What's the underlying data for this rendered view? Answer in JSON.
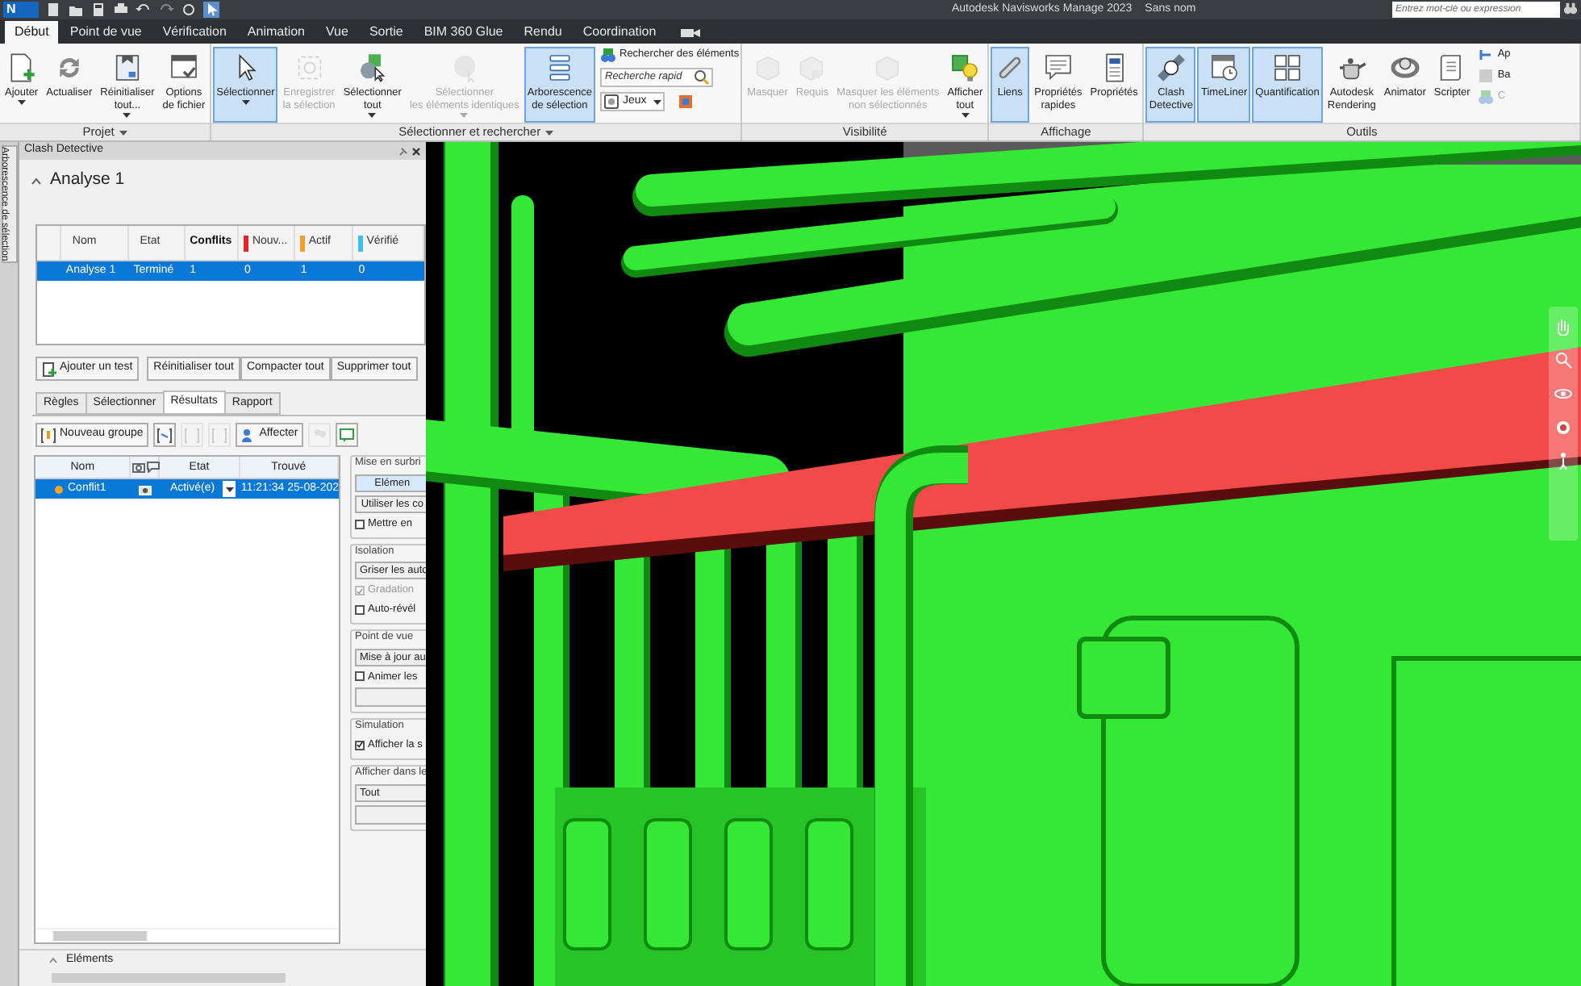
{
  "title_bar": {
    "logo": "N",
    "app_title": "Autodesk Navisworks Manage 2023",
    "document_title": "Sans nom",
    "search": {
      "placeholder": "Entrez mot-clé ou expression"
    }
  },
  "ribbon_tabs": [
    {
      "label": "Début",
      "selected": true
    },
    {
      "label": "Point de vue",
      "selected": false
    },
    {
      "label": "Vérification",
      "selected": false
    },
    {
      "label": "Animation",
      "selected": false
    },
    {
      "label": "Vue",
      "selected": false
    },
    {
      "label": "Sortie",
      "selected": false
    },
    {
      "label": "BIM 360 Glue",
      "selected": false
    },
    {
      "label": "Rendu",
      "selected": false
    },
    {
      "label": "Coordination",
      "selected": false
    }
  ],
  "ribbon_groups": [
    {
      "label": "Projet",
      "items": [
        {
          "kind": "large",
          "label": "Ajouter",
          "dropdown": true,
          "selected": false,
          "disabled": false
        },
        {
          "kind": "large",
          "label": "Actualiser",
          "dropdown": false,
          "selected": false,
          "disabled": false
        },
        {
          "kind": "large",
          "label": "Réinitialiser\ntout...",
          "dropdown": true,
          "selected": false,
          "disabled": false
        },
        {
          "kind": "large",
          "label": "Options\nde fichier",
          "dropdown": false,
          "selected": false,
          "disabled": false
        }
      ]
    },
    {
      "label": "Sélectionner et rechercher",
      "items": [
        {
          "kind": "large",
          "label": "Sélectionner",
          "dropdown": true,
          "selected": true,
          "disabled": false
        },
        {
          "kind": "large",
          "label": "Enregistrer\nla sélection",
          "dropdown": false,
          "selected": false,
          "disabled": true
        },
        {
          "kind": "large",
          "label": "Sélectionner\ntout",
          "dropdown": true,
          "selected": false,
          "disabled": false
        },
        {
          "kind": "large",
          "label": "Sélectionner\nles éléments identiques",
          "dropdown": true,
          "selected": false,
          "disabled": true
        },
        {
          "kind": "large",
          "label": "Arborescence\nde sélection",
          "dropdown": false,
          "selected": true,
          "disabled": false
        },
        {
          "kind": "stack",
          "entries": [
            {
              "kind": "link",
              "label": "Rechercher des éléments"
            },
            {
              "kind": "search",
              "placeholder": "Recherche rapid"
            },
            {
              "kind": "select",
              "label": "Jeux"
            }
          ]
        }
      ]
    },
    {
      "label": "Visibilité",
      "items": [
        {
          "kind": "large",
          "label": "Masquer",
          "dropdown": false,
          "selected": false,
          "disabled": true
        },
        {
          "kind": "large",
          "label": "Requis",
          "dropdown": false,
          "selected": false,
          "disabled": true
        },
        {
          "kind": "large",
          "label": "Masquer les éléments\nnon sélectionnés",
          "dropdown": false,
          "selected": false,
          "disabled": true
        },
        {
          "kind": "large",
          "label": "Afficher\ntout",
          "dropdown": true,
          "selected": false,
          "disabled": false
        }
      ]
    },
    {
      "label": "Affichage",
      "items": [
        {
          "kind": "large",
          "label": "Liens",
          "dropdown": false,
          "selected": true,
          "disabled": false
        },
        {
          "kind": "large",
          "label": "Propriétés\nrapides",
          "dropdown": false,
          "selected": false,
          "disabled": false
        },
        {
          "kind": "large",
          "label": "Propriétés",
          "dropdown": false,
          "selected": false,
          "disabled": false
        }
      ]
    },
    {
      "label": "Outils",
      "items": [
        {
          "kind": "large",
          "label": "Clash\nDetective",
          "dropdown": false,
          "selected": true,
          "disabled": false
        },
        {
          "kind": "large",
          "label": "TimeLiner",
          "dropdown": false,
          "selected": true,
          "disabled": false
        },
        {
          "kind": "large",
          "label": "Quantification",
          "dropdown": false,
          "selected": true,
          "disabled": false
        },
        {
          "kind": "large",
          "label": "Autodesk\nRendering",
          "dropdown": false,
          "selected": false,
          "disabled": false
        },
        {
          "kind": "large",
          "label": "Animator",
          "dropdown": false,
          "selected": false,
          "disabled": false
        },
        {
          "kind": "large",
          "label": "Scripter",
          "dropdown": false,
          "selected": false,
          "disabled": false
        },
        {
          "kind": "stack",
          "entries": [
            {
              "kind": "link",
              "label": "Ap"
            },
            {
              "kind": "link",
              "label": "Ba"
            },
            {
              "kind": "disabled_link",
              "label": "C"
            }
          ]
        }
      ]
    }
  ],
  "side_tab": {
    "label": "Arborescence de sélection"
  },
  "clash_detective": {
    "title": "Clash Detective",
    "test_name": "Analyse 1",
    "tests_table": {
      "columns": [
        {
          "label": "Nom",
          "kind": "text"
        },
        {
          "label": "Etat",
          "kind": "text"
        },
        {
          "label": "Conflits",
          "kind": "total"
        },
        {
          "label": "Nouv...",
          "kind": "status",
          "color": "#e0262c"
        },
        {
          "label": "Actif",
          "kind": "status",
          "color": "#f0a030"
        },
        {
          "label": "Vérifié",
          "kind": "status",
          "color": "#3cc0e8"
        }
      ],
      "rows": [
        {
          "selected": true,
          "cells": [
            "Analyse 1",
            "Terminé",
            "1",
            "0",
            "1",
            "0"
          ]
        }
      ]
    },
    "test_buttons": [
      "Ajouter un test",
      "Réinitialiser tout",
      "Compacter tout",
      "Supprimer tout"
    ],
    "tabs": [
      {
        "label": "Règles",
        "selected": false
      },
      {
        "label": "Sélectionner",
        "selected": false
      },
      {
        "label": "Résultats",
        "selected": true
      },
      {
        "label": "Rapport",
        "selected": false
      }
    ],
    "results_toolbar": [
      {
        "kind": "labeled",
        "label": "Nouveau groupe",
        "disabled": false
      },
      {
        "kind": "icon",
        "disabled": false
      },
      {
        "kind": "icon",
        "disabled": true
      },
      {
        "kind": "icon",
        "disabled": true
      },
      {
        "kind": "labeled",
        "label": "Affecter",
        "disabled": false
      },
      {
        "kind": "icon",
        "disabled": true
      },
      {
        "kind": "icon",
        "disabled": false
      }
    ],
    "results_table": {
      "columns": [
        "Nom",
        "Etat",
        "Trouvé"
      ],
      "rows": [
        {
          "name": "Conflit1",
          "color": "#f5a623",
          "status": "Activé(e)",
          "found": "11:21:34 25-08-202",
          "selected": true
        }
      ]
    },
    "options": [
      {
        "title": "Mise en surbri",
        "controls": [
          {
            "kind": "button",
            "label": "Elémen",
            "selected": true
          },
          {
            "kind": "button",
            "label": "Utiliser les co",
            "selected": false
          },
          {
            "kind": "checkbox",
            "label": "Mettre en",
            "checked": false,
            "disabled": false
          }
        ]
      },
      {
        "title": "Isolation",
        "controls": [
          {
            "kind": "dropdown",
            "label": "Griser les auto"
          },
          {
            "kind": "checkbox",
            "label": "Gradation",
            "checked": true,
            "disabled": true
          },
          {
            "kind": "checkbox",
            "label": "Auto-révél",
            "checked": false,
            "disabled": false
          }
        ]
      },
      {
        "title": "Point de vue",
        "controls": [
          {
            "kind": "dropdown",
            "label": "Mise à jour au"
          },
          {
            "kind": "checkbox",
            "label": "Animer les",
            "checked": false,
            "disabled": false
          },
          {
            "kind": "blank_button"
          }
        ]
      },
      {
        "title": "Simulation",
        "controls": [
          {
            "kind": "checkbox",
            "label": "Afficher la s",
            "checked": true,
            "disabled": false
          }
        ]
      },
      {
        "title": "Afficher dans le",
        "controls": [
          {
            "kind": "dropdown",
            "label": "Tout"
          },
          {
            "kind": "blank_button"
          }
        ]
      }
    ],
    "elements_section": {
      "label": "Eléments"
    }
  }
}
